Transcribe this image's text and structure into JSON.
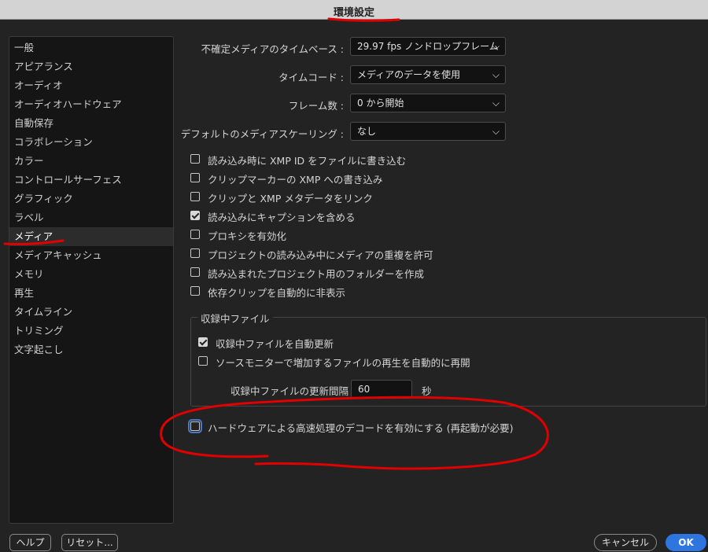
{
  "window": {
    "title": "環境設定"
  },
  "sidebar": {
    "items": [
      "一般",
      "アピアランス",
      "オーディオ",
      "オーディオハードウェア",
      "自動保存",
      "コラボレーション",
      "カラー",
      "コントロールサーフェス",
      "グラフィック",
      "ラベル",
      "メディア",
      "メディアキャッシュ",
      "メモリ",
      "再生",
      "タイムライン",
      "トリミング",
      "文字起こし"
    ],
    "selected": "メディア"
  },
  "settings": {
    "timebase": {
      "label": "不確定メディアのタイムベース :",
      "value": "29.97 fps ノンドロップフレーム"
    },
    "timecode": {
      "label": "タイムコード :",
      "value": "メディアのデータを使用"
    },
    "frame_count": {
      "label": "フレーム数 :",
      "value": "0 から開始"
    },
    "scaling": {
      "label": "デフォルトのメディアスケーリング :",
      "value": "なし"
    }
  },
  "checkboxes": [
    {
      "label": "読み込み時に XMP ID をファイルに書き込む",
      "checked": false
    },
    {
      "label": "クリップマーカーの XMP への書き込み",
      "checked": false
    },
    {
      "label": "クリップと XMP メタデータをリンク",
      "checked": false
    },
    {
      "label": "読み込みにキャプションを含める",
      "checked": true
    },
    {
      "label": "プロキシを有効化",
      "checked": false
    },
    {
      "label": "プロジェクトの読み込み中にメディアの重複を許可",
      "checked": false
    },
    {
      "label": "読み込まれたプロジェクト用のフォルダーを作成",
      "checked": false
    },
    {
      "label": "依存クリップを自動的に非表示",
      "checked": false
    }
  ],
  "growing_files": {
    "title": "収録中ファイル",
    "auto_refresh": {
      "label": "収録中ファイルを自動更新",
      "checked": true
    },
    "auto_resume": {
      "label": "ソースモニターで増加するファイルの再生を自動的に再開",
      "checked": false
    },
    "interval_label": "収録中ファイルの更新間隔",
    "interval_value": "60",
    "interval_unit": "秒"
  },
  "hw_decode": {
    "label": "ハードウェアによる高速処理のデコードを有効にする (再起動が必要)",
    "checked": false
  },
  "buttons": {
    "help": "ヘルプ",
    "reset": "リセット...",
    "cancel": "キャンセル",
    "ok": "OK"
  },
  "colors": {
    "annotation": "#e00000",
    "primary": "#2f75e0"
  }
}
